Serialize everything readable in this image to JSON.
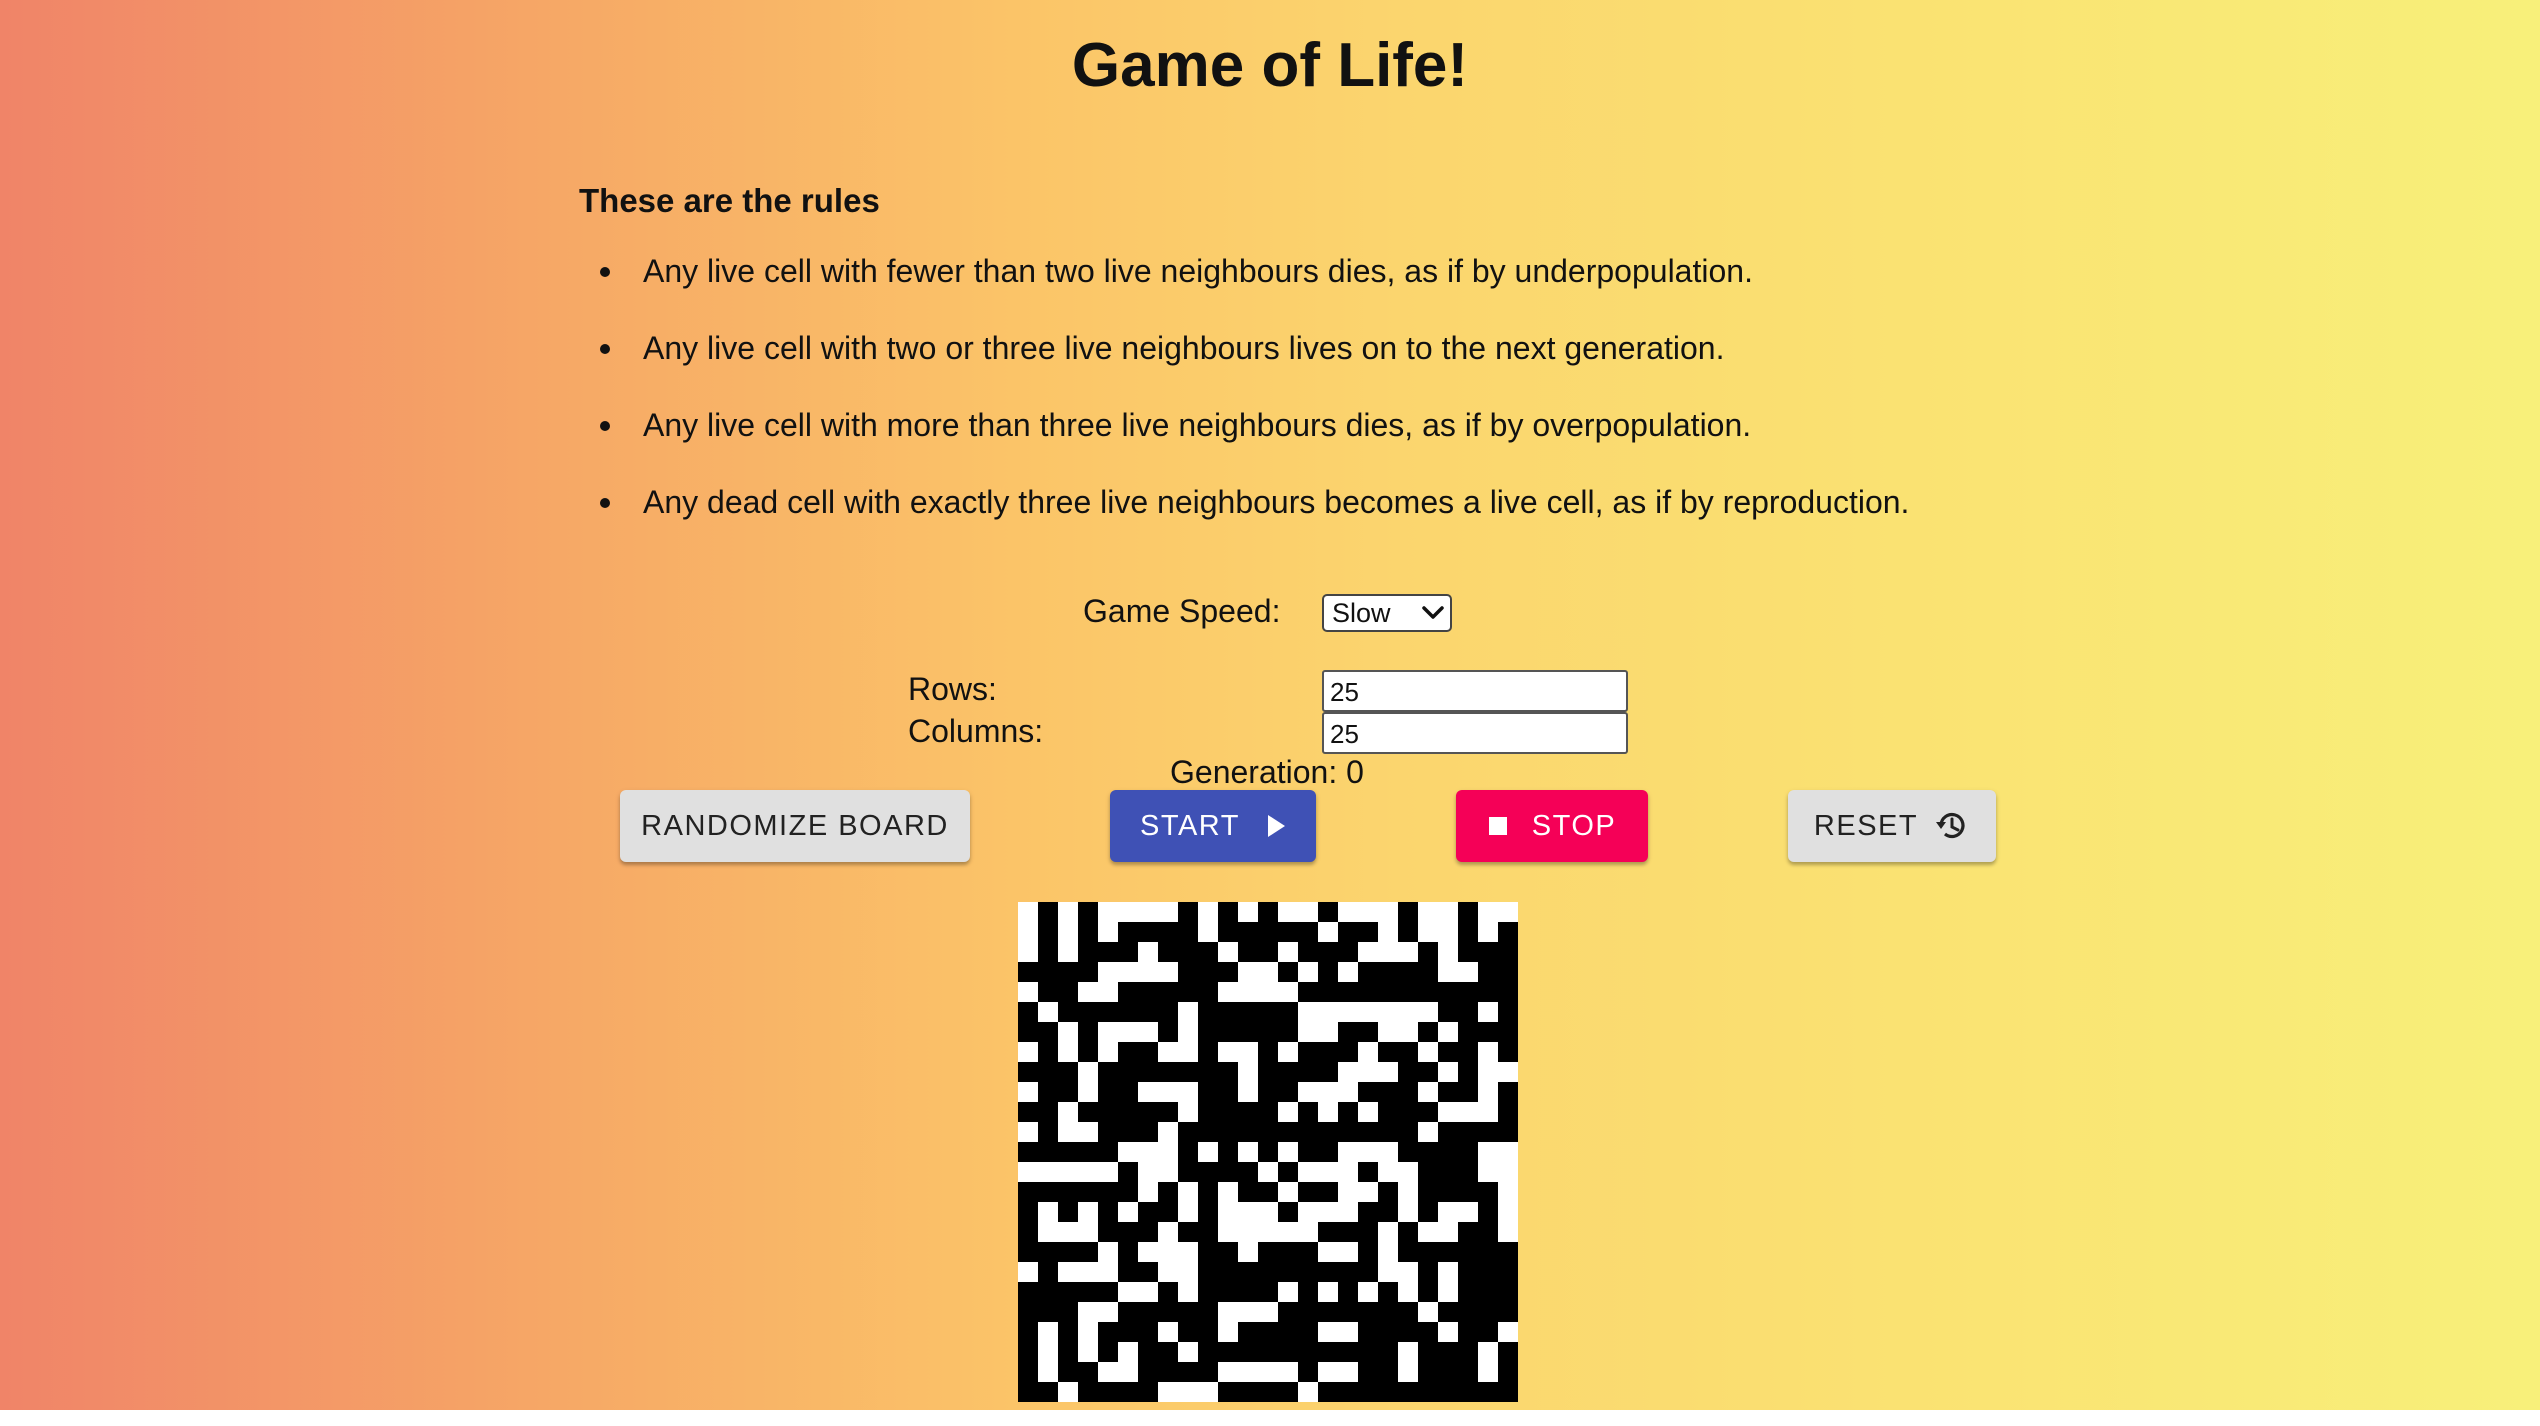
{
  "title": "Game of Life!",
  "rules": {
    "heading": "These are the rules",
    "items": [
      "Any live cell with fewer than two live neighbours dies, as if by underpopulation.",
      "Any live cell with two or three live neighbours lives on to the next generation.",
      "Any live cell with more than three live neighbours dies, as if by overpopulation.",
      "Any dead cell with exactly three live neighbours becomes a live cell, as if by reproduction."
    ]
  },
  "controls": {
    "speed_label": "Game Speed:",
    "speed_value": "Slow",
    "rows_label": "Rows:",
    "rows_value": "25",
    "columns_label": "Columns:",
    "columns_value": "25",
    "generation_text": "Generation: 0"
  },
  "buttons": {
    "randomize": "RANDOMIZE BOARD",
    "start": "START",
    "stop": "STOP",
    "reset": "RESET"
  },
  "icons": {
    "start": "play-icon",
    "stop": "stop-square-icon",
    "reset": "history-icon",
    "select": "chevron-down-icon"
  },
  "colors": {
    "start_button": "#3f51b5",
    "stop_button": "#f50057",
    "default_button": "#e0e0e0",
    "live_cell": "#000000",
    "dead_cell": "#ffffff"
  },
  "board": {
    "rows": [
      "0101000010101001000100100",
      "0101011110111110110100101",
      "0101110111011011100010111",
      "1111000011100101011110011",
      "0110011111000011111111111",
      "1011111101111100000001101",
      "1101000101111100110010111",
      "0101011001001011101101101",
      "1110111111101111000110100",
      "0110110001101100011101101",
      "1101111101111010101110001",
      "0100111011111111111101111",
      "1111100010101011000111100",
      "0000010011110100010011100",
      "1111110101011011001011110",
      "1010101101000100011010010",
      "1000111011000001110100110",
      "1111010001101110010111111",
      "0100011001111111110010111",
      "1111100101111010101010111",
      "1110011111000111111101111",
      "1010111011011110011110110",
      "1010101101111111111011101",
      "1011001111000010011011101",
      "1101111000111101111111111"
    ]
  }
}
